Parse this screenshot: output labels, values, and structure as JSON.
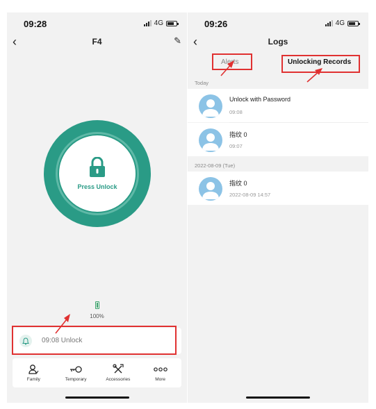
{
  "left_screen": {
    "status": {
      "time": "09:28",
      "network": "4G"
    },
    "nav": {
      "title": "F4",
      "back_icon": "chevron-left-icon",
      "edit_icon": "pencil-icon"
    },
    "unlock": {
      "label": "Press Unlock",
      "icon": "lock-icon",
      "accent": "#2a9b86"
    },
    "battery": {
      "percent": "100%",
      "level": 1.0,
      "color": "#3aa36b"
    },
    "last_log": {
      "text": "09:08  Unlock",
      "icon": "bell-icon"
    },
    "tabs": [
      {
        "label": "Family",
        "icon": "family-icon"
      },
      {
        "label": "Temporary",
        "icon": "key-icon"
      },
      {
        "label": "Accessories",
        "icon": "tools-icon"
      },
      {
        "label": "More",
        "icon": "more-dots-icon"
      }
    ]
  },
  "right_screen": {
    "status": {
      "time": "09:26",
      "network": "4G"
    },
    "nav": {
      "title": "Logs",
      "back_icon": "chevron-left-icon"
    },
    "segments": {
      "alerts": "Alerts",
      "records": "Unlocking Records"
    },
    "sections": [
      {
        "header": "Today",
        "entries": [
          {
            "title": "Unlock with Password",
            "time": "09:08"
          },
          {
            "title": "指纹 0",
            "time": "09:07"
          }
        ]
      },
      {
        "header": "2022-08-09 (Tue)",
        "entries": [
          {
            "title": "指纹 0",
            "time": "2022-08-09 14:57"
          }
        ]
      }
    ]
  },
  "colors": {
    "highlight": "#e03131",
    "avatar": "#8cc3e6",
    "background": "#f2f2f2"
  }
}
